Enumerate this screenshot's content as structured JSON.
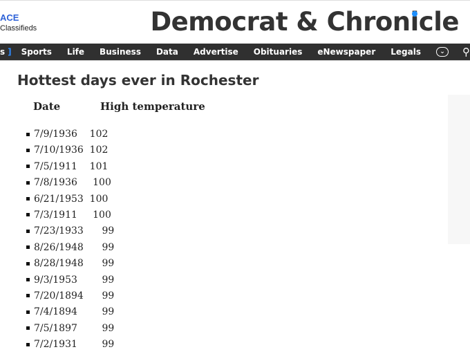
{
  "brand": {
    "name": "ACE",
    "sub": "Classifieds"
  },
  "logo": {
    "text_before": "Democrat & Chron",
    "text_i": "i",
    "text_after": "cle"
  },
  "nav": {
    "partial": "s",
    "bracket": "]",
    "items": [
      "Sports",
      "Life",
      "Business",
      "Data",
      "Advertise",
      "Obituaries",
      "eNewspaper",
      "Legals"
    ],
    "more_icon": "chevron-down-icon",
    "search_icon": "search-icon"
  },
  "article": {
    "title": "Hottest days ever in Rochester",
    "col_date": "Date",
    "col_temp": "High temperature",
    "rows": [
      "7/9/1936    102",
      "7/10/1936  102",
      "7/5/1911    101",
      "7/8/1936     100",
      "6/21/1953  100",
      "7/3/1911     100",
      "7/23/1933      99",
      "8/26/1948      99",
      "8/28/1948      99",
      "9/3/1953        99",
      "7/20/1894      99",
      "7/4/1894        99",
      "7/5/1897        99",
      "7/2/1931        99"
    ]
  }
}
